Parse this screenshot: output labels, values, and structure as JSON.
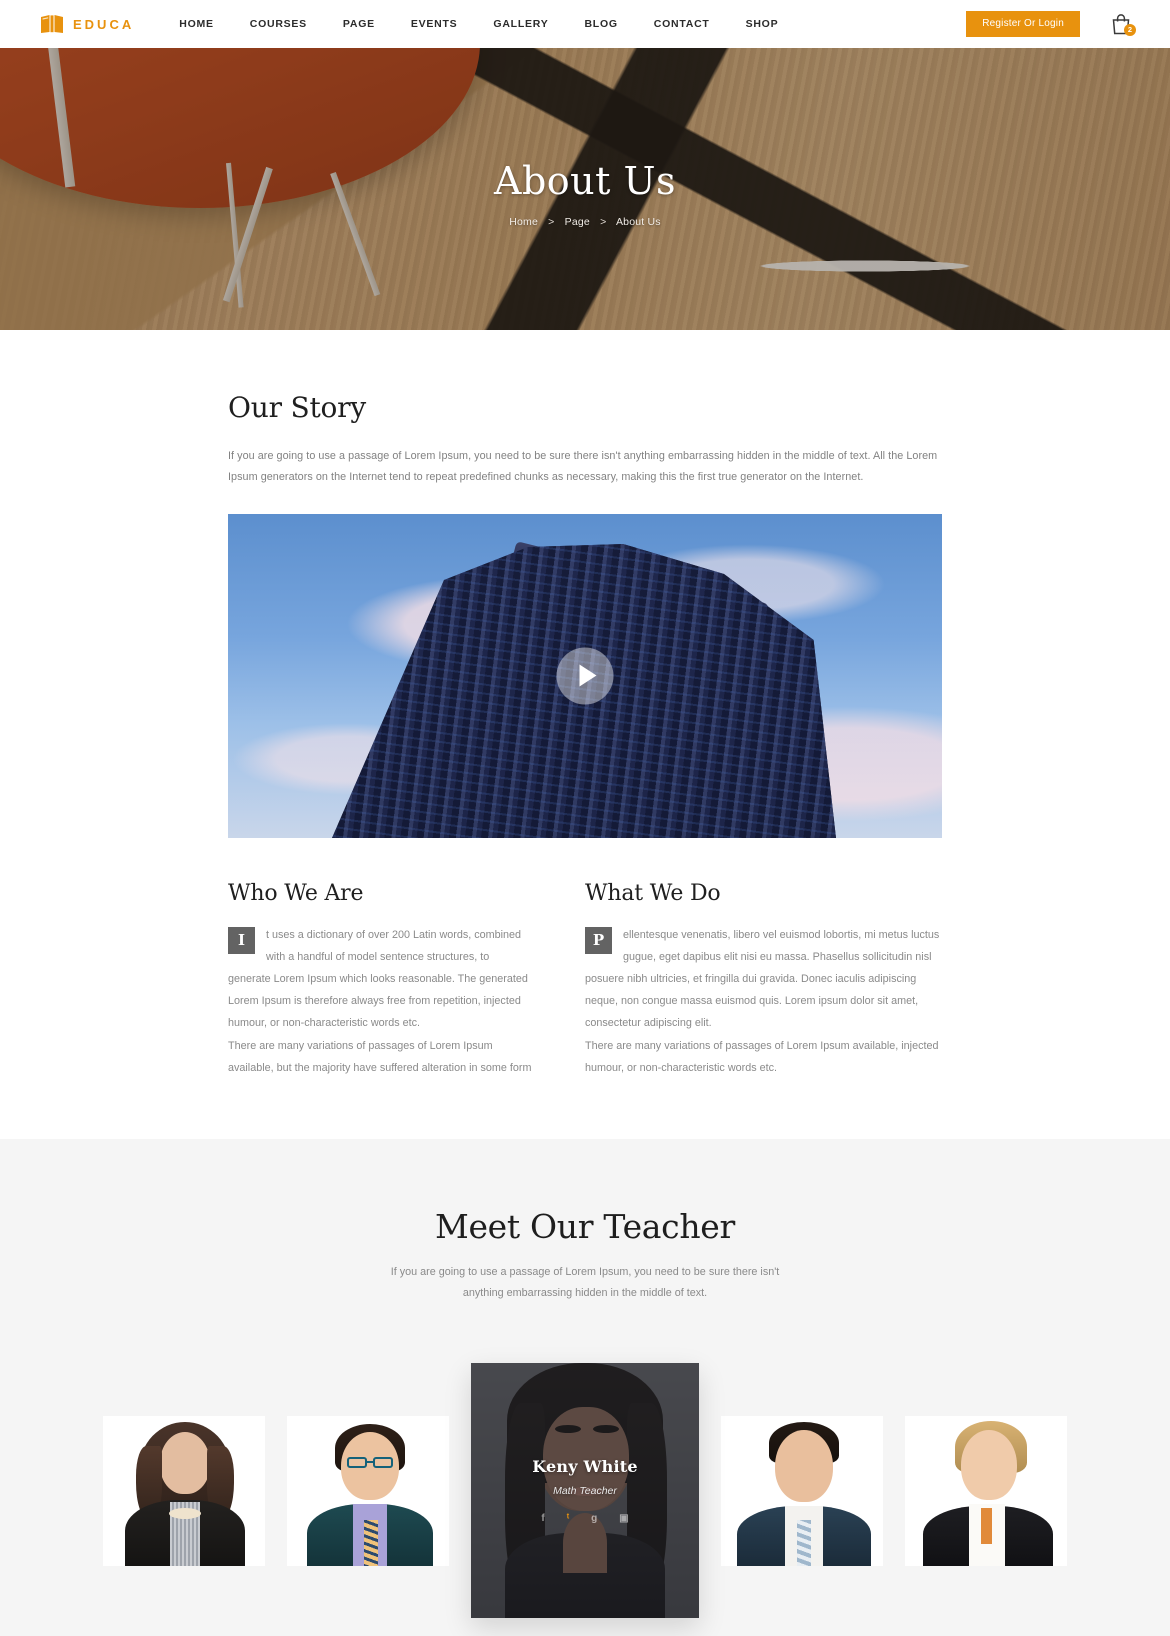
{
  "header": {
    "brand": "EDUCA",
    "nav": [
      {
        "label": "HOME"
      },
      {
        "label": "COURSES"
      },
      {
        "label": "PAGE"
      },
      {
        "label": "EVENTS"
      },
      {
        "label": "GALLERY"
      },
      {
        "label": "BLOG"
      },
      {
        "label": "CONTACT"
      },
      {
        "label": "SHOP"
      }
    ],
    "register_label": "Register Or Login",
    "cart_count": "2",
    "accent_color": "#E8920E"
  },
  "hero": {
    "title": "About Us",
    "breadcrumb": {
      "home": "Home",
      "sep1": ">",
      "page": "Page",
      "sep2": ">",
      "current": "About Us"
    }
  },
  "story": {
    "title": "Our Story",
    "paragraph": "If you are going to use a passage of Lorem Ipsum, you need to be sure there isn't anything embarrassing hidden in the middle of text. All the Lorem Ipsum generators on the Internet tend to repeat predefined chunks as necessary, making this the first true generator on the Internet.",
    "video_play_label": "Play video"
  },
  "who_we_are": {
    "title": "Who We Are",
    "dropcap": "I",
    "paragraph1": "t uses a dictionary of over 200 Latin words, combined with a handful of model sentence structures, to generate Lorem Ipsum which looks reasonable. The generated Lorem Ipsum is therefore always free from repetition, injected humour, or non-characteristic words etc.",
    "paragraph2": "There are many variations of passages of Lorem Ipsum available, but the majority have suffered alteration in some form"
  },
  "what_we_do": {
    "title": "What We Do",
    "dropcap": "P",
    "paragraph1": "ellentesque venenatis, libero vel euismod lobortis, mi metus luctus gugue, eget dapibus elit nisi eu massa. Phasellus sollicitudin nisl posuere nibh ultricies, et fringilla dui gravida. Donec iaculis adipiscing neque, non congue massa euismod quis. Lorem ipsum dolor sit amet, consectetur adipiscing elit.",
    "paragraph2": "There are many variations of passages of Lorem Ipsum available, injected humour, or non-characteristic words etc."
  },
  "teachers": {
    "title": "Meet Our Teacher",
    "subtitle": "If you are going to use a passage of Lorem Ipsum, you need to be sure there isn't anything embarrassing hidden in the middle of text.",
    "active_card": {
      "name": "Keny White",
      "role": "Math Teacher",
      "social": [
        {
          "icon": "facebook-icon",
          "glyph": "f"
        },
        {
          "icon": "twitter-icon",
          "glyph": "ᵗ"
        },
        {
          "icon": "google-plus-icon",
          "glyph": "g"
        },
        {
          "icon": "instagram-icon",
          "glyph": "▣"
        }
      ]
    },
    "cards": [
      {
        "id": "teacher-1"
      },
      {
        "id": "teacher-2"
      },
      {
        "id": "teacher-3"
      },
      {
        "id": "teacher-4"
      },
      {
        "id": "teacher-5"
      }
    ]
  }
}
